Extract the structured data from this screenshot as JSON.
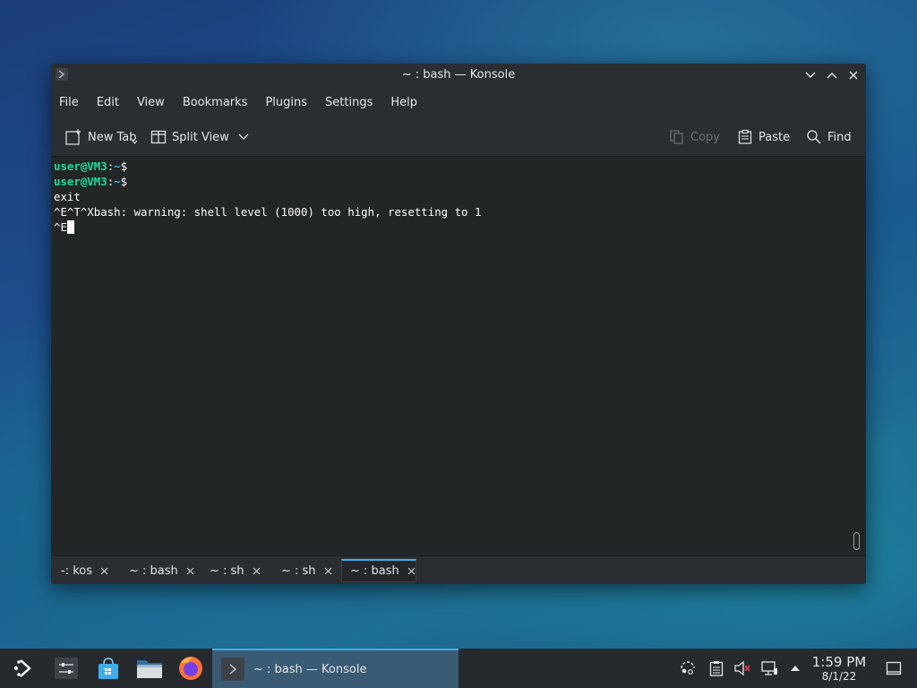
{
  "window": {
    "title": "~ : bash — Konsole"
  },
  "menubar": {
    "items": [
      "File",
      "Edit",
      "View",
      "Bookmarks",
      "Plugins",
      "Settings",
      "Help"
    ]
  },
  "toolbar": {
    "new_tab": "New Tab",
    "split_view": "Split View",
    "copy": "Copy",
    "paste": "Paste",
    "find": "Find"
  },
  "terminal": {
    "prompt_user": "user@VM3",
    "prompt_sep": ":",
    "prompt_path": "~",
    "prompt_symbol": "$",
    "line3": "exit",
    "line4": "^E^T^Xbash: warning: shell level (1000) too high, resetting to 1",
    "line5": "^E"
  },
  "tabs": [
    {
      "label": "-: kos",
      "active": false
    },
    {
      "label": "~ : bash",
      "active": false
    },
    {
      "label": "~ : sh",
      "active": false
    },
    {
      "label": "~ : sh",
      "active": false
    },
    {
      "label": "~ : bash",
      "active": true
    }
  ],
  "taskbar": {
    "task_title": "~ : bash — Konsole",
    "time": "1:59 PM",
    "date": "8/1/22"
  },
  "colors": {
    "accent": "#3daee9",
    "prompt_user": "#1cdc9a",
    "terminal_bg": "#232627"
  }
}
